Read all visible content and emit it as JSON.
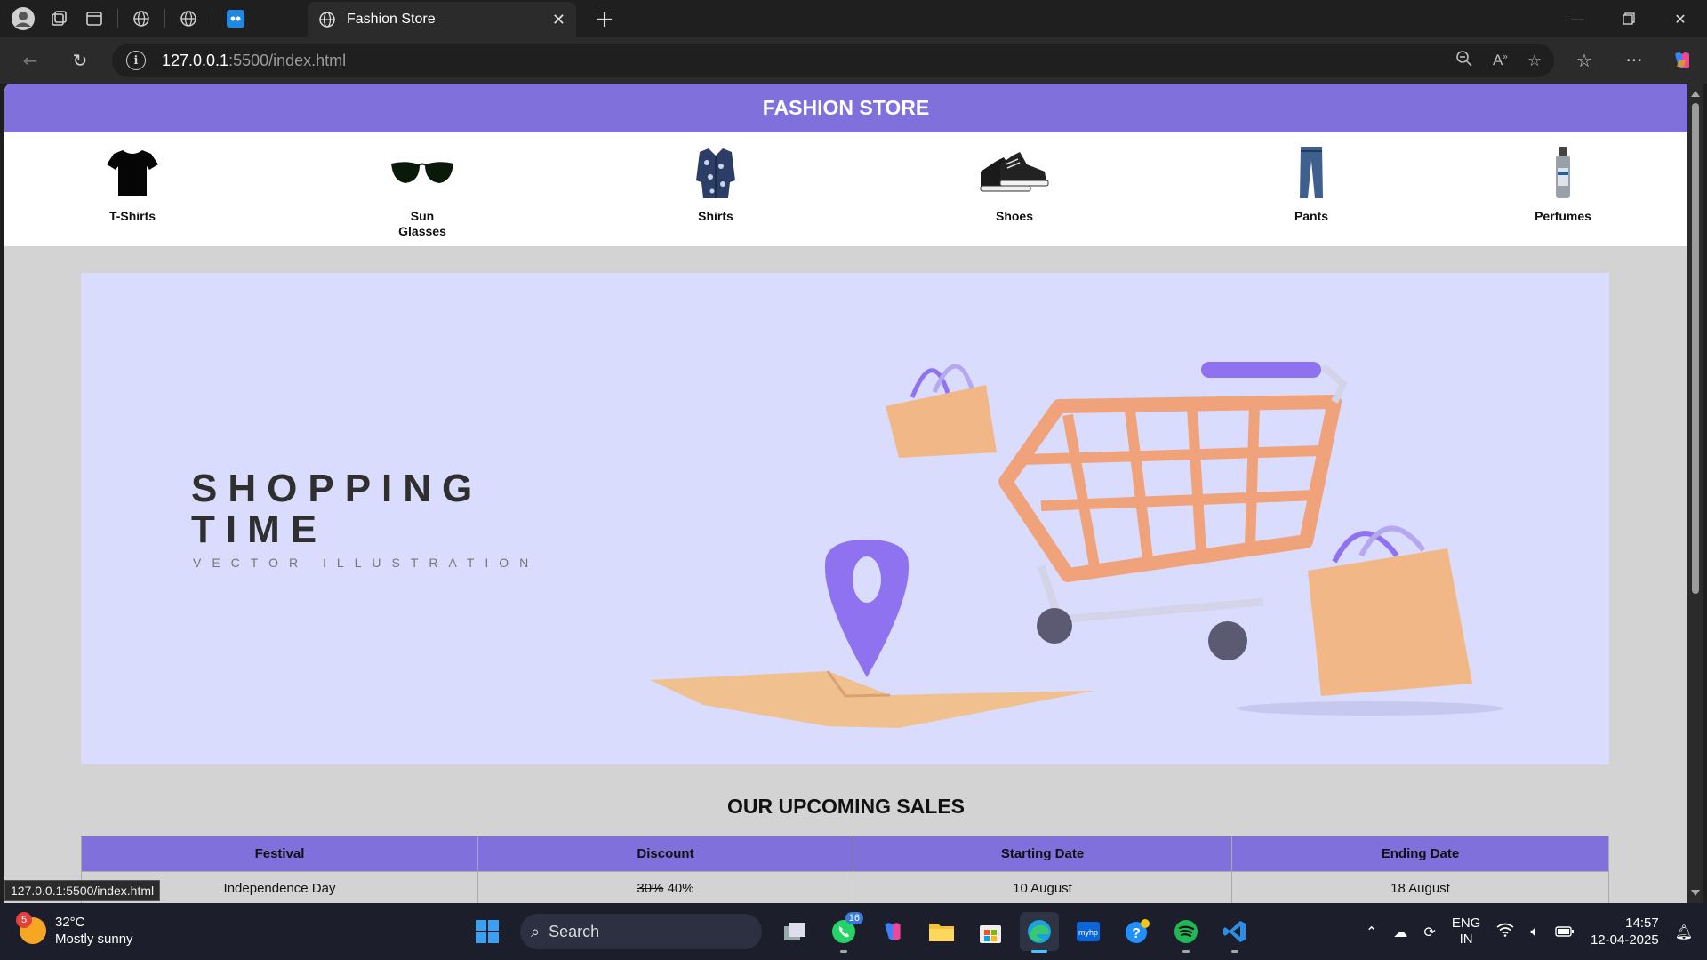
{
  "browser": {
    "tab_title": "Fashion Store",
    "url_host": "127.0.0.1",
    "url_rest": ":5500/index.html",
    "status_link": "127.0.0.1:5500/index.html"
  },
  "store": {
    "title": "FASHION STORE",
    "categories": [
      {
        "label": "T-Shirts",
        "icon": "tshirt-icon"
      },
      {
        "label": "Sun Glasses",
        "icon": "sunglasses-icon"
      },
      {
        "label": "Shirts",
        "icon": "shirt-icon"
      },
      {
        "label": "Shoes",
        "icon": "shoes-icon"
      },
      {
        "label": "Pants",
        "icon": "pants-icon"
      },
      {
        "label": "Perfumes",
        "icon": "perfume-icon"
      }
    ],
    "banner": {
      "line1": "SHOPPING",
      "line2": "TIME",
      "subtitle": "VECTOR ILLUSTRATION",
      "bg_color": "#d9dcfc"
    },
    "sales": {
      "title": "OUR UPCOMING SALES",
      "headers": [
        "Festival",
        "Discount",
        "Starting Date",
        "Ending Date"
      ],
      "rows": [
        {
          "festival": "Independence Day",
          "old_discount": "30%",
          "discount": "40%",
          "start": "10 August",
          "end": "18 August"
        }
      ]
    },
    "accent_color": "#8070dc"
  },
  "taskbar": {
    "weather_temp": "32°C",
    "weather_desc": "Mostly sunny",
    "weather_badge": "5",
    "search_label": "Search",
    "whatsapp_badge": "16",
    "lang_line1": "ENG",
    "lang_line2": "IN",
    "time": "14:57",
    "date": "12-04-2025"
  }
}
